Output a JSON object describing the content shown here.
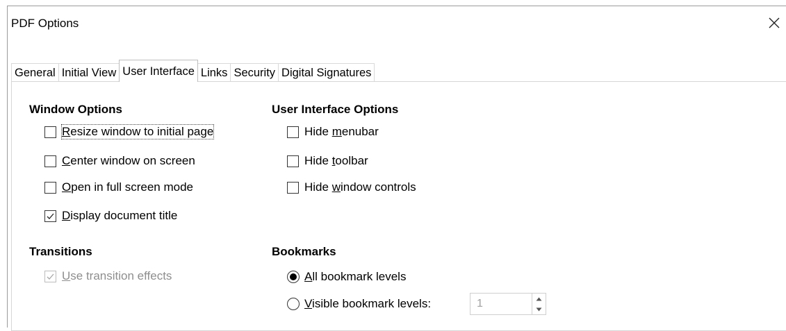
{
  "dialog": {
    "title": "PDF Options"
  },
  "tabs": [
    {
      "label": "General"
    },
    {
      "label": "Initial View"
    },
    {
      "label": "User Interface"
    },
    {
      "label": "Links"
    },
    {
      "label": "Security"
    },
    {
      "label": "Digital Signatures"
    }
  ],
  "window_options": {
    "heading": "Window Options",
    "resize": {
      "u": "R",
      "rest": "esize window to initial page",
      "checked": false
    },
    "center": {
      "u": "C",
      "rest": "enter window on screen",
      "checked": false
    },
    "fullscreen": {
      "u": "O",
      "rest": "pen in full screen mode",
      "checked": false
    },
    "doc_title": {
      "u": "D",
      "rest": "isplay document title",
      "checked": true
    }
  },
  "ui_options": {
    "heading": "User Interface Options",
    "menubar": {
      "pre": "Hide ",
      "u": "m",
      "rest": "enubar",
      "checked": false
    },
    "toolbar": {
      "pre": "Hide ",
      "u": "t",
      "rest": "oolbar",
      "checked": false
    },
    "window_controls": {
      "pre": "Hide ",
      "u": "w",
      "rest": "indow controls",
      "checked": false
    }
  },
  "transitions": {
    "heading": "Transitions",
    "use_effects": {
      "u": "U",
      "rest": "se transition effects",
      "checked": true,
      "disabled": true
    }
  },
  "bookmarks": {
    "heading": "Bookmarks",
    "all_levels": {
      "u": "A",
      "rest": "ll bookmark levels",
      "selected": true
    },
    "visible_levels": {
      "u": "V",
      "rest": "isible bookmark levels:",
      "selected": false
    },
    "levels_value": "1"
  }
}
